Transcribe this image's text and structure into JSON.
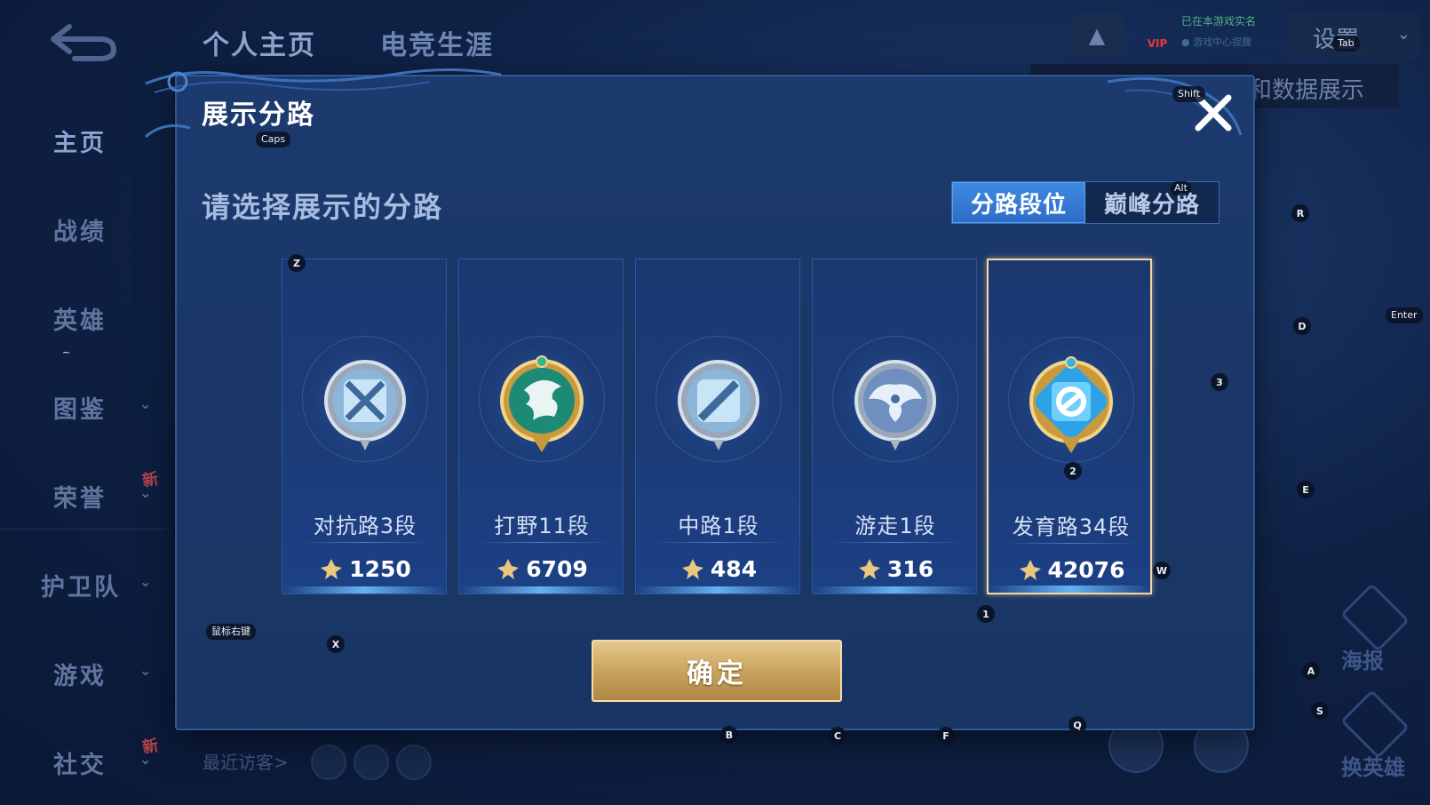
{
  "topbar": {
    "tabs": [
      "个人主页",
      "电竞生涯"
    ],
    "vip_label": "VIP",
    "realname_line1": "已在本游戏实名",
    "realname_line2": "● 游戏中心提醒",
    "settings_label": "设置",
    "banner_text": "表和数据展示"
  },
  "sidebar": {
    "items": [
      {
        "label": "主页"
      },
      {
        "label": "战绩"
      },
      {
        "label": "英雄"
      },
      {
        "label": "图鉴"
      },
      {
        "label": "荣誉"
      },
      {
        "label": "护卫队"
      },
      {
        "label": "游戏"
      },
      {
        "label": "社交"
      }
    ],
    "new_badge": "新"
  },
  "bottom": {
    "visitors_label": "最近访客>",
    "right_label_1": "海报",
    "right_label_2": "换英雄"
  },
  "modal": {
    "title": "展示分路",
    "prompt": "请选择展示的分路",
    "tabs": [
      {
        "label": "分路段位",
        "active": true
      },
      {
        "label": "巅峰分路",
        "active": false
      }
    ],
    "lanes": [
      {
        "name": "对抗路3段",
        "score": "1250",
        "icon": "clash-lane-badge-icon",
        "selected": false
      },
      {
        "name": "打野11段",
        "score": "6709",
        "icon": "jungle-dragon-badge-icon",
        "selected": false
      },
      {
        "name": "中路1段",
        "score": "484",
        "icon": "mid-lane-badge-icon",
        "selected": false
      },
      {
        "name": "游走1段",
        "score": "316",
        "icon": "roam-wings-badge-icon",
        "selected": false
      },
      {
        "name": "发育路34段",
        "score": "42076",
        "icon": "farm-lane-badge-icon",
        "selected": true
      }
    ],
    "confirm_label": "确定"
  },
  "key_hints": {
    "caps": "Caps",
    "shift": "Shift",
    "alt": "Alt",
    "tab": "Tab",
    "enter": "Enter",
    "mouse_right": "鼠标右键",
    "z": "Z",
    "x": "X",
    "w": "W",
    "r": "R",
    "d": "D",
    "e": "E",
    "a": "A",
    "s": "S",
    "q": "Q",
    "b": "B",
    "c": "C",
    "f": "F",
    "n1": "1",
    "n2": "2",
    "n3": "3",
    "tilde": "~"
  },
  "colors": {
    "accent_blue": "#2d6dc8",
    "selected_border": "#f3d7a5",
    "confirm_gold": "#c9a45e"
  }
}
